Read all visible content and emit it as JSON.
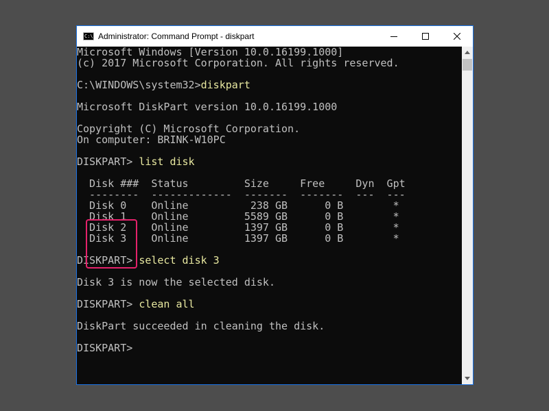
{
  "window": {
    "title": "Administrator: Command Prompt - diskpart",
    "icon_text": "C:\\"
  },
  "icons": {
    "app": "command-prompt-icon",
    "minimize": "minimize-icon",
    "maximize": "maximize-icon",
    "close": "close-icon",
    "scroll_up": "scroll-up-arrow-icon",
    "scroll_down": "scroll-down-arrow-icon"
  },
  "colors": {
    "console_bg": "#0c0c0c",
    "console_text": "#c0c0c0",
    "command_text": "#e8e8a0",
    "highlight_border": "#e5226b",
    "window_border": "#1a73e8"
  },
  "console": {
    "lines": [
      {
        "text": "Microsoft Windows [Version 10.0.16199.1000]"
      },
      {
        "text": "(c) 2017 Microsoft Corporation. All rights reserved."
      },
      {
        "text": ""
      },
      {
        "text": "C:\\WINDOWS\\system32>",
        "cmd": "diskpart"
      },
      {
        "text": ""
      },
      {
        "text": "Microsoft DiskPart version 10.0.16199.1000"
      },
      {
        "text": ""
      },
      {
        "text": "Copyright (C) Microsoft Corporation."
      },
      {
        "text": "On computer: BRINK-W10PC"
      },
      {
        "text": ""
      },
      {
        "text": "DISKPART> ",
        "cmd": "list disk"
      },
      {
        "text": ""
      },
      {
        "text": "  Disk ###  Status         Size     Free     Dyn  Gpt"
      },
      {
        "text": "  --------  -------------  -------  -------  ---  ---"
      },
      {
        "text": "  Disk 0    Online          238 GB      0 B        *"
      },
      {
        "text": "  Disk 1    Online         5589 GB      0 B        *"
      },
      {
        "text": "  Disk 2    Online         1397 GB      0 B        *"
      },
      {
        "text": "  Disk 3    Online         1397 GB      0 B        *"
      },
      {
        "text": ""
      },
      {
        "text": "DISKPART> ",
        "cmd": "select disk 3"
      },
      {
        "text": ""
      },
      {
        "text": "Disk 3 is now the selected disk."
      },
      {
        "text": ""
      },
      {
        "text": "DISKPART> ",
        "cmd": "clean all"
      },
      {
        "text": ""
      },
      {
        "text": "DiskPart succeeded in cleaning the disk."
      },
      {
        "text": ""
      },
      {
        "text": "DISKPART>"
      }
    ]
  }
}
